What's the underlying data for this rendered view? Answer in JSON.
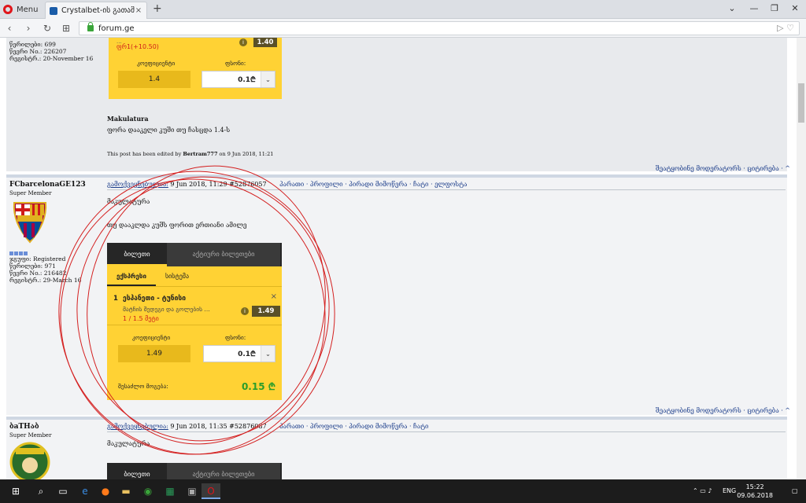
{
  "browser": {
    "menu_label": "Menu",
    "tab_title": "Crystalbet-ის გათამაშუ…",
    "tab_close": "×",
    "new_tab": "+",
    "url": "forum.ge",
    "win_min": "—",
    "win_restore": "❐",
    "win_close": "✕",
    "win_extra": "⌄"
  },
  "post1": {
    "stats": [
      "წერილები: 699",
      "წევრი No.: 226207",
      "რეგისტრ.: 20-November 16"
    ],
    "slip_odds_text": "ფრ1(+10.50)",
    "slip_odds_badge": "1.40",
    "slip_top_line": "...",
    "coef_label": "კოეფიციენტი",
    "stake_label": "ფსონი:",
    "coef_value": "1.4",
    "stake_value": "0.1₾",
    "author": "Makulatura",
    "text": "ფორა დააკელი კუში თუ ჩასცდა 1.4-ს",
    "edit_note_prefix": "This post has been edited by ",
    "edit_user": "Bertram777",
    "edit_note_suffix": " on 9 Jun 2018, 11:21",
    "footer": "შეატყობინე მოდერატორს  · ციტირება · ^"
  },
  "post2": {
    "username": "FCbarcelonaGE123",
    "rank": "Super Member",
    "group": "ჯგუფი: Registered",
    "stats": [
      "წერილები: 971",
      "წევრი No.: 216482",
      "რეგისტრ.: 29-March 16"
    ],
    "header_link": "გამოქვეყნებულია:",
    "header_date": " 9 Jun 2018, 11:29",
    "header_id": " #52876057",
    "header_actions": "პარათი · პროფილი · პირადი მიმოწერა · ჩატი · ელფოსტა",
    "line1": "მაკულატურა",
    "line2": "თუ დააკლდა კუშს ფორით ერთიანი ამილე",
    "slip": {
      "tab_active": "ბილეთი",
      "tab_inactive": "აქტიური ბილეთები",
      "sub_active": "ექსპრესი",
      "sub_inactive": "სისტემა",
      "match_num": "1",
      "match": "ესპანეთი - ტუნისი",
      "market": "მატჩის შედეგი და გოლების ...",
      "pick": "1 / 1.5 მეტი",
      "odds": "1.49",
      "remove": "×",
      "coef_label": "კოეფიციენტი",
      "stake_label": "ფსონი:",
      "coef_value": "1.49",
      "stake_value": "0.1₾",
      "payout_label": "შესაძლო მოგება:",
      "payout_value": "0.15 ₾"
    },
    "footer": "შეატყობინე მოდერატორს  · ციტირება · ^"
  },
  "post3": {
    "username": "ბaTHაბ",
    "rank": "Super Member",
    "header_link": "გამოქვეყნებულია:",
    "header_date": " 9 Jun 2018, 11:35",
    "header_id": " #52876087",
    "header_actions": "პარათი · პროფილი · პირადი მიმოწერა · ჩატი",
    "line1": "მაკულატურა",
    "slip_tab_active": "ბილეთი",
    "slip_tab_inactive": "აქტიური ბილეთები"
  },
  "taskbar": {
    "lang": "ENG",
    "time": "15:22",
    "date": "09.06.2018"
  },
  "colors": {
    "slip_yellow": "#ffd234",
    "annotation_red": "#d42020"
  }
}
